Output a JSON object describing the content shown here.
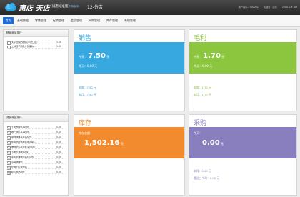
{
  "topbar": {
    "logo_text": "惠店 天店",
    "edition": "(试用标准版)",
    "switch_link": "切换版本",
    "store_name": "12-分店",
    "info": [
      "用户口口：000002",
      "欢迎您：店长",
      "2000-1-X Tue"
    ]
  },
  "nav": {
    "items": [
      "首页",
      "基础数据",
      "零售管理",
      "促销管理",
      "会员管理",
      "采购管理",
      "库存管理",
      "系统管理"
    ]
  },
  "hot_ranking": {
    "title": "畅销商品排行",
    "rows": [
      {
        "no": "1",
        "name": "大平台纯奶的组(平日口区)",
        "value": "1.00"
      },
      {
        "no": "2",
        "name": "上好佳不同款分管理物…",
        "value": "1.00"
      }
    ]
  },
  "slow_ranking": {
    "title": "滞销商品排行",
    "rows": [
      {
        "no": "1",
        "name": "王老吉罐装310ml",
        "value": "0.00"
      },
      {
        "no": "2",
        "name": "统一冰红茶250ML",
        "value": "0.00"
      },
      {
        "no": "3",
        "name": "康师傅绿茶装500ml",
        "value": "0.00"
      },
      {
        "no": "4",
        "name": "凯嘉杭的添加剂水清爽…",
        "value": "0.00"
      },
      {
        "no": "5",
        "name": "雅蜂全尖在水蜂宝500g",
        "value": "0.00"
      },
      {
        "no": "6",
        "name": "五丰农温鲜500g",
        "value": "0.00"
      },
      {
        "no": "7",
        "name": "蒙牛原味酸牛奶450ml",
        "value": "0.00"
      },
      {
        "no": "8",
        "name": "清露鲜味中",
        "value": "0.00"
      },
      {
        "no": "9",
        "name": "长城干红葡萄酒",
        "value": "0.00"
      },
      {
        "no": "10",
        "name": "和小的吃啦吃",
        "value": "0.00"
      }
    ]
  },
  "sales": {
    "title": "销售",
    "today_label": "今天：",
    "today_value": "7.50",
    "unit": "元",
    "yesterday": "昨天：0.00 元",
    "week": "本周：7.50 元",
    "month": "本月：7.50 元"
  },
  "profit": {
    "title": "毛利",
    "today_label": "今天：",
    "today_value": "1.70",
    "unit": "元",
    "yesterday": "昨天：0.00 元",
    "week": "本周：1.70 元",
    "month": "本月：1.70 元"
  },
  "stock": {
    "title": "库存",
    "amount_label": "库存金额：",
    "amount_value": "1,502.16",
    "unit": "元"
  },
  "purchase": {
    "title": "采购",
    "today_label": "今天：",
    "today_value": "0.00",
    "unit": "元",
    "month": "本月：0.00 元",
    "last_three": "最近三个月：0.00 元"
  },
  "colors": {
    "nav_active": "#1e6bd6",
    "sales": "#38a8e0",
    "profit": "#8cc63f",
    "stock": "#f28a2e",
    "purchase": "#8a7fbe"
  }
}
